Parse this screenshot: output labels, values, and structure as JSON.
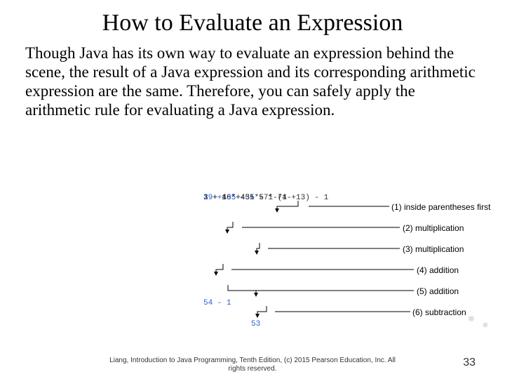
{
  "title": "How to Evaluate an Expression",
  "body": "Though Java has its own way to evaluate an expression behind the scene, the result of a Java expression and its corresponding arithmetic expression are the same. Therefore, you can safely apply the arithmetic rule for evaluating a Java expression.",
  "steps": {
    "line1": "3 + 4 * 4 + 5 * (4 + 3) - 1",
    "line2": "3 + 4 * 4 + 5 * 7 - 1",
    "line3": "3 + 16 + 5 * 7 - 1",
    "line4": "3 + 16 + 35 - 1",
    "line5": "19 + 35 - 1",
    "line6": "54 - 1",
    "line7": "53"
  },
  "annotations": {
    "a1": "(1) inside parentheses first",
    "a2": "(2) multiplication",
    "a3": "(3) multiplication",
    "a4": "(4) addition",
    "a5": "(5) addition",
    "a6": "(6) subtraction"
  },
  "footer": {
    "line1": "Liang, Introduction to Java Programming, Tenth Edition, (c) 2015 Pearson Education, Inc. All",
    "line2": "rights reserved."
  },
  "page": "33"
}
